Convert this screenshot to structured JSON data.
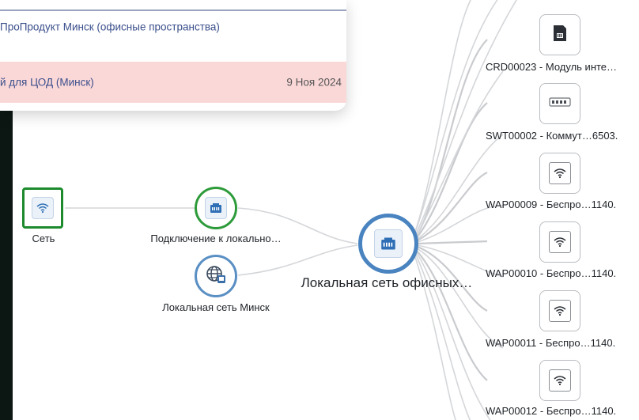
{
  "overlay": {
    "rows": [
      {
        "text": "ПроПродукт Минск (офисные пространства)",
        "date": ""
      },
      {
        "text": "й для ЦОД (Минск)",
        "date": "9 Ноя 2024"
      }
    ]
  },
  "graph": {
    "nodes": {
      "network": {
        "label": "Сеть",
        "icon": "wifi-icon"
      },
      "lan_connection": {
        "label": "Подключение к локально…",
        "icon": "ethernet-icon"
      },
      "lan_minsk": {
        "label": "Локальная сеть Минск",
        "icon": "globe-icon"
      },
      "lan_office": {
        "label": "Локальная сеть офисных…",
        "icon": "ethernet-icon"
      },
      "devices": [
        {
          "label": "CRD00023 - Модуль инте…",
          "icon": "card-module-icon"
        },
        {
          "label": "SWT00002 - Коммут…6503.",
          "icon": "switch-icon"
        },
        {
          "label": "WAP00009 - Беспро…1140.",
          "icon": "wifi-icon"
        },
        {
          "label": "WAP00010 - Беспро…1140.",
          "icon": "wifi-icon"
        },
        {
          "label": "WAP00011 - Беспро…1140.",
          "icon": "wifi-icon"
        },
        {
          "label": "WAP00012 - Беспро…1140.",
          "icon": "wifi-icon"
        }
      ]
    }
  },
  "colors": {
    "accent_green": "#2e9b3a",
    "accent_blue": "#4a84c0",
    "highlight_row": "#fbd8d8",
    "link_text": "#3b4f8c"
  }
}
